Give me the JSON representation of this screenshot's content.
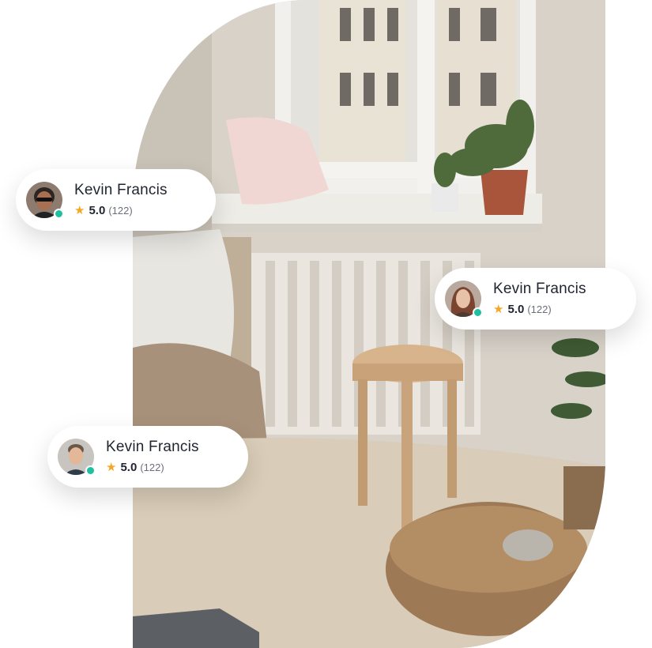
{
  "colors": {
    "star": "#f5a623",
    "online": "#1ec0a0",
    "name_text": "#1f2430",
    "count_text": "#6b6f78"
  },
  "icons": {
    "rating": "star-icon",
    "status": "online-status-dot"
  },
  "reviews": [
    {
      "name": "Kevin Francis",
      "star": "★",
      "score": "5.0",
      "count": "(122)"
    },
    {
      "name": "Kevin Francis",
      "star": "★",
      "score": "5.0",
      "count": "(122)"
    },
    {
      "name": "Kevin Francis",
      "star": "★",
      "score": "5.0",
      "count": "(122)"
    }
  ]
}
